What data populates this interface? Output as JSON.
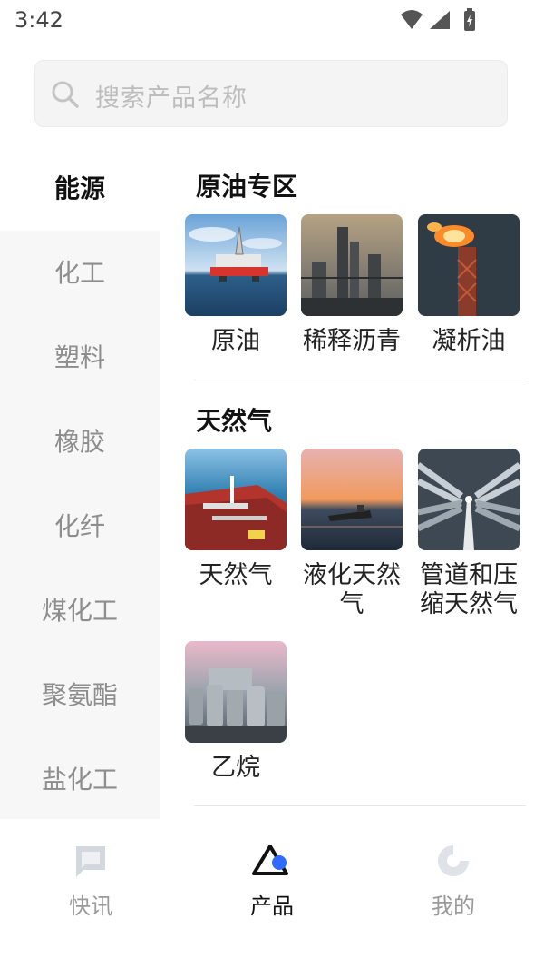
{
  "status_bar": {
    "time": "3:42"
  },
  "search": {
    "placeholder": "搜索产品名称"
  },
  "sidebar": {
    "items": [
      {
        "label": "能源",
        "active": true
      },
      {
        "label": "化工"
      },
      {
        "label": "塑料"
      },
      {
        "label": "橡胶"
      },
      {
        "label": "化纤"
      },
      {
        "label": "煤化工"
      },
      {
        "label": "聚氨酯"
      },
      {
        "label": "盐化工"
      }
    ]
  },
  "sections": [
    {
      "title": "原油专区",
      "products": [
        {
          "name": "原油",
          "image": "offshore-oil-rig"
        },
        {
          "name": "稀释沥青",
          "image": "refinery-towers"
        },
        {
          "name": "凝析油",
          "image": "gas-flare-stack"
        }
      ]
    },
    {
      "title": "天然气",
      "products": [
        {
          "name": "天然气",
          "image": "tanker-deck"
        },
        {
          "name": "液化天然气",
          "image": "lng-ship-sunset"
        },
        {
          "name": "管道和压缩天然气",
          "image": "pipeline-corridor"
        },
        {
          "name": "乙烷",
          "image": "storage-tanks"
        }
      ]
    }
  ],
  "tabbar": {
    "items": [
      {
        "label": "快讯",
        "icon": "news-chat-icon"
      },
      {
        "label": "产品",
        "icon": "product-triangle-icon",
        "active": true
      },
      {
        "label": "我的",
        "icon": "profile-pie-icon"
      }
    ]
  },
  "colors": {
    "accent": "#2f6bff",
    "sidebar_bg": "#f7f7f7",
    "inactive_text": "#8d8d8d"
  }
}
